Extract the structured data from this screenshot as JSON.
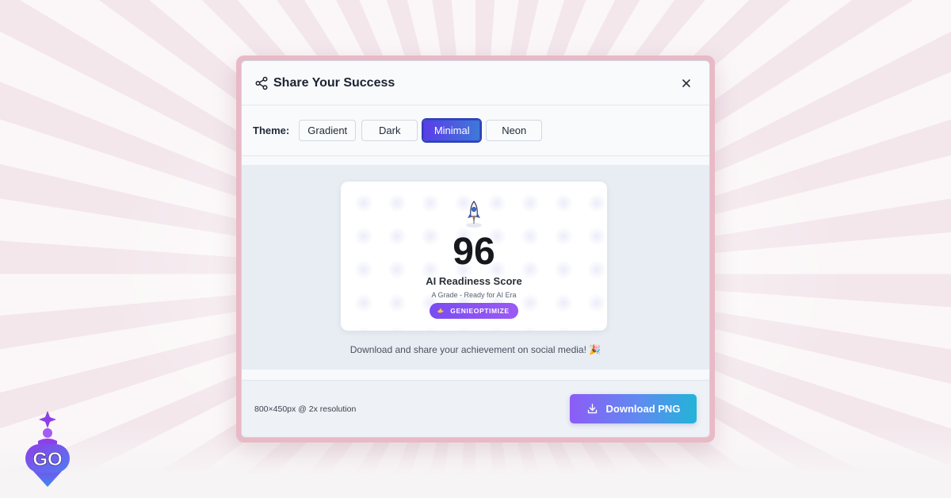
{
  "modal": {
    "title": "Share Your Success",
    "close_icon": "close-icon",
    "share_icon": "share-icon"
  },
  "theme": {
    "label": "Theme:",
    "options": [
      "Gradient",
      "Dark",
      "Minimal",
      "Neon"
    ],
    "selected": "Minimal"
  },
  "card": {
    "icon": "rocket-icon",
    "score": "96",
    "score_label": "AI Readiness Score",
    "grade": "A Grade - Ready for AI Era",
    "brand": "GENIEOPTIMIZE"
  },
  "caption": "Download and share your achievement on social media! 🎉",
  "footer": {
    "resolution": "800×450px @ 2x resolution",
    "download_label": "Download PNG",
    "download_icon": "download-icon"
  },
  "logo": {
    "text": "GO"
  },
  "colors": {
    "accent_purple": "#7a4cf0",
    "accent_blue": "#3f78d8",
    "download_gradient_end": "#22b4d8",
    "frame_pink": "#e9b9c6"
  }
}
